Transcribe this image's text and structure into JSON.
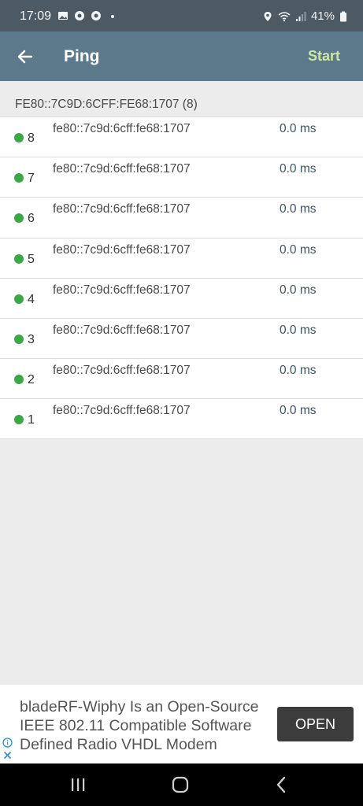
{
  "status_bar": {
    "time": "17:09",
    "battery": "41%",
    "icons": [
      "image-icon",
      "chrome-icon",
      "chrome-icon",
      "dot-icon",
      "location-icon",
      "wifi-icon",
      "signal-icon",
      "battery-icon"
    ]
  },
  "app_bar": {
    "title": "Ping",
    "start_label": "Start",
    "back_icon": "arrow-left-icon"
  },
  "section": {
    "header": "FE80::7C9D:6CFF:FE68:1707 (8)"
  },
  "results": [
    {
      "seq": "8",
      "address": "fe80::7c9d:6cff:fe68:1707",
      "time": "0.0 ms"
    },
    {
      "seq": "7",
      "address": "fe80::7c9d:6cff:fe68:1707",
      "time": "0.0 ms"
    },
    {
      "seq": "6",
      "address": "fe80::7c9d:6cff:fe68:1707",
      "time": "0.0 ms"
    },
    {
      "seq": "5",
      "address": "fe80::7c9d:6cff:fe68:1707",
      "time": "0.0 ms"
    },
    {
      "seq": "4",
      "address": "fe80::7c9d:6cff:fe68:1707",
      "time": "0.0 ms"
    },
    {
      "seq": "3",
      "address": "fe80::7c9d:6cff:fe68:1707",
      "time": "0.0 ms"
    },
    {
      "seq": "2",
      "address": "fe80::7c9d:6cff:fe68:1707",
      "time": "0.0 ms"
    },
    {
      "seq": "1",
      "address": "fe80::7c9d:6cff:fe68:1707",
      "time": "0.0 ms"
    }
  ],
  "ad": {
    "lines": [
      "bladeRF-Wiphy Is an Open-Source",
      "IEEE 802.11 Compatible Software",
      "Defined Radio VHDL Modem"
    ],
    "open_label": "OPEN"
  },
  "colors": {
    "status_bar": "#4d5a64",
    "app_bar": "#5c7a8b",
    "accent_start": "#cfe6a0",
    "ok_dot": "#3aa845",
    "time_text": "#3d5566"
  }
}
